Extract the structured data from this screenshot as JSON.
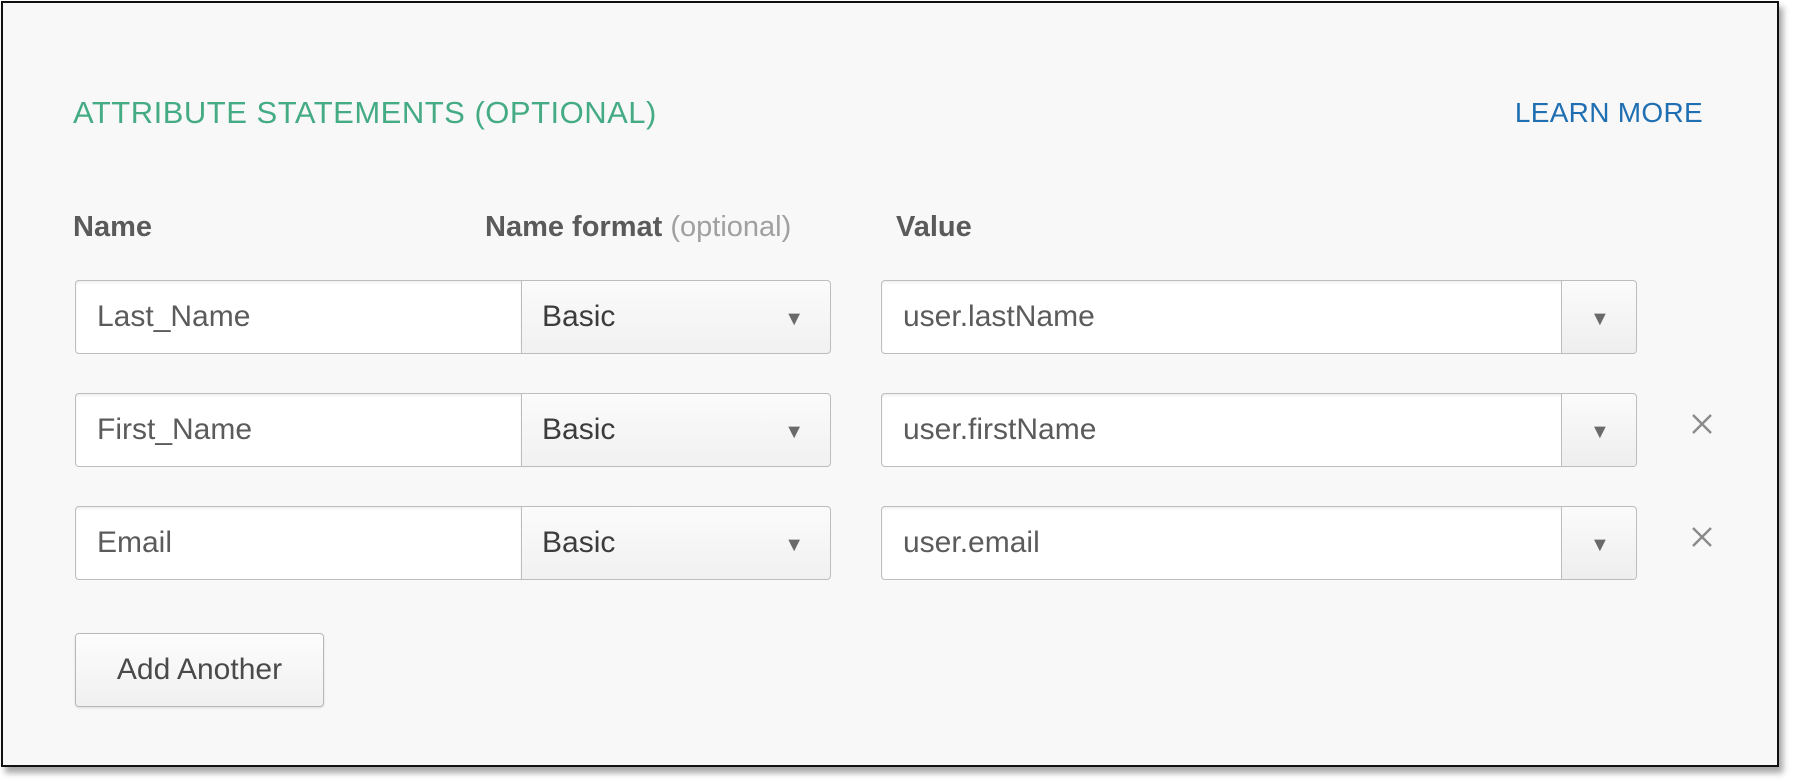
{
  "section": {
    "title": "ATTRIBUTE STATEMENTS (OPTIONAL)",
    "learn_more": "LEARN MORE"
  },
  "columns": {
    "name": "Name",
    "name_format": "Name format",
    "name_format_hint": "(optional)",
    "value": "Value"
  },
  "rows": [
    {
      "name": "Last_Name",
      "format": "Basic",
      "value": "user.lastName",
      "removable": false
    },
    {
      "name": "First_Name",
      "format": "Basic",
      "value": "user.firstName",
      "removable": true
    },
    {
      "name": "Email",
      "format": "Basic",
      "value": "user.email",
      "removable": true
    }
  ],
  "icons": {
    "dropdown": "chevron-down-icon",
    "remove": "close-icon"
  },
  "actions": {
    "add_another": "Add Another"
  },
  "colors": {
    "title": "#44ab85",
    "link": "#1f6fb2"
  }
}
